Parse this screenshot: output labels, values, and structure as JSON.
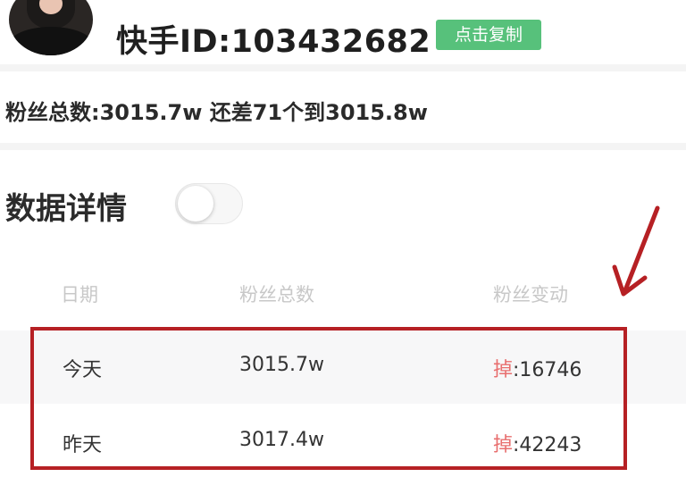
{
  "profile": {
    "kuaishou_id": "快手ID:103432682",
    "copy_button": "点击复制"
  },
  "fans_summary": "粉丝总数:3015.7w 还差71个到3015.8w",
  "details": {
    "title": "数据详情",
    "toggle_on": false
  },
  "table": {
    "headers": [
      "日期",
      "粉丝总数",
      "粉丝变动"
    ],
    "rows": [
      {
        "date": "今天",
        "total": "3015.7w",
        "change_label": "掉",
        "change_value": ":16746"
      },
      {
        "date": "昨天",
        "total": "3017.4w",
        "change_label": "掉",
        "change_value": ":42243"
      }
    ]
  },
  "colors": {
    "copy_button_bg": "#57c17b",
    "highlight_border": "#b62024",
    "drop_text": "#e86f6f"
  }
}
